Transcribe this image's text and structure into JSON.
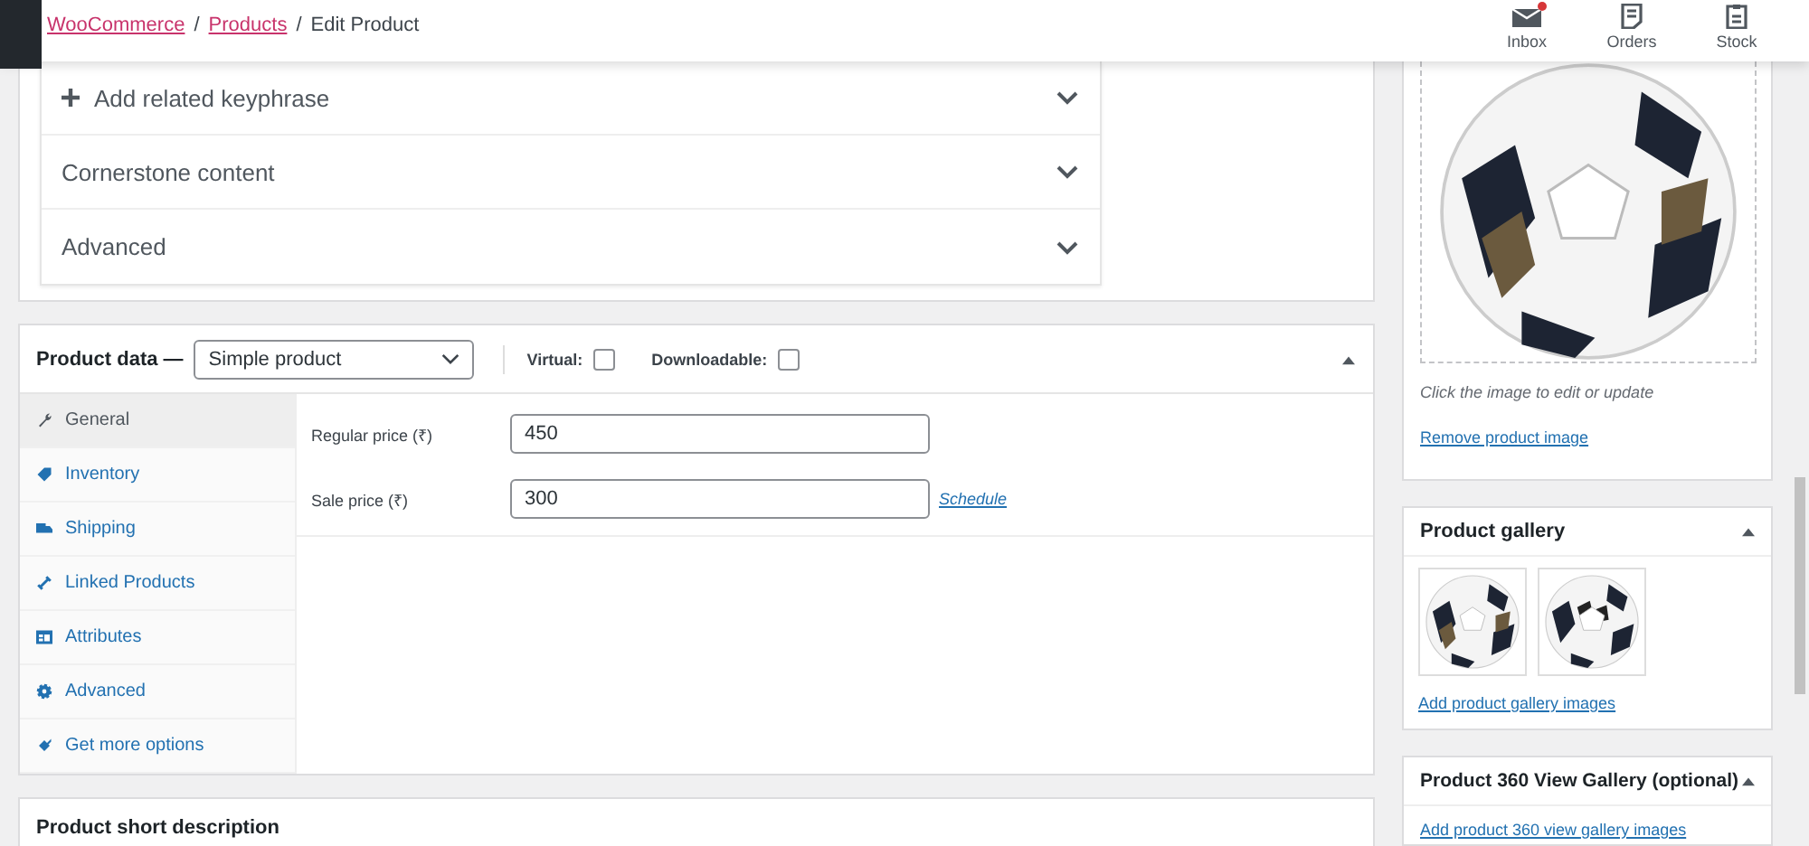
{
  "breadcrumb_separator": "/",
  "breadcrumb": [
    {
      "label": "WooCommerce",
      "kind": "link"
    },
    {
      "label": "Products",
      "kind": "link"
    },
    {
      "label": "Edit Product",
      "kind": "current"
    }
  ],
  "activity_bar": [
    {
      "label": "Inbox",
      "kind": "inbox",
      "unread": true
    },
    {
      "label": "Orders",
      "kind": "orders",
      "unread": false
    },
    {
      "label": "Stock",
      "kind": "stock",
      "unread": false
    }
  ],
  "seo_sections": [
    {
      "label": "Add related keyphrase",
      "kind": "add"
    },
    {
      "label": "Cornerstone content",
      "kind": "plain"
    },
    {
      "label": "Advanced",
      "kind": "plain"
    }
  ],
  "product_data": {
    "title": "Product data —",
    "type_select": {
      "value": "Simple product"
    },
    "options": [
      {
        "label": "Virtual:",
        "checked": false
      },
      {
        "label": "Downloadable:",
        "checked": false
      }
    ],
    "tabs": [
      {
        "label": "General",
        "kind": "general",
        "selected": true
      },
      {
        "label": "Inventory",
        "kind": "inventory",
        "selected": false
      },
      {
        "label": "Shipping",
        "kind": "shipping",
        "selected": false
      },
      {
        "label": "Linked Products",
        "kind": "linked",
        "selected": false
      },
      {
        "label": "Attributes",
        "kind": "attributes",
        "selected": false
      },
      {
        "label": "Advanced",
        "kind": "advanced",
        "selected": false
      },
      {
        "label": "Get more options",
        "kind": "more",
        "selected": false
      }
    ],
    "fields": [
      {
        "label": "Regular price (₹)",
        "value": "450"
      },
      {
        "label": "Sale price (₹)",
        "value": "300",
        "link": "Schedule"
      }
    ]
  },
  "product_image": {
    "hint": "Click the image to edit or update",
    "link": "Remove product image"
  },
  "product_gallery": {
    "title": "Product gallery",
    "link": "Add product gallery images"
  },
  "gallery_360": {
    "title": "Product 360 View Gallery (optional)",
    "link": "Add product 360 view gallery images"
  },
  "short_description": {
    "title": "Product short description"
  }
}
